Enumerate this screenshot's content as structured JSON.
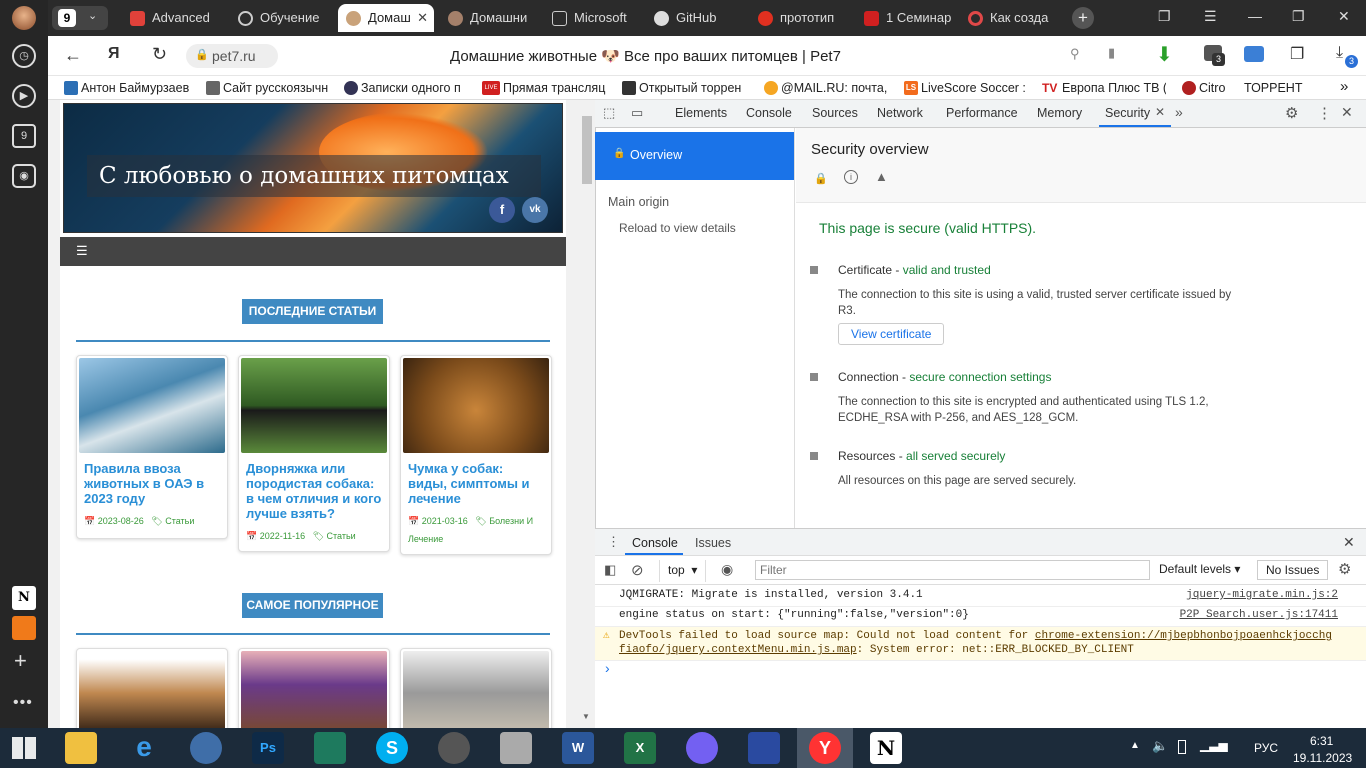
{
  "tabs": [
    {
      "label": "Advanced",
      "icon": "vivaldi-icon"
    },
    {
      "label": "Обучение",
      "icon": "openai-icon"
    },
    {
      "label": "Домаш",
      "icon": "pug-icon",
      "active": true
    },
    {
      "label": "Домашни",
      "icon": "pug-icon"
    },
    {
      "label": "Microsoft",
      "icon": "document-icon"
    },
    {
      "label": "GitHub",
      "icon": "github-icon"
    },
    {
      "label": "прототип",
      "icon": "yandex-icon"
    },
    {
      "label": "1 Семинар",
      "icon": "book-icon"
    },
    {
      "label": "Как созда",
      "icon": "record-icon"
    }
  ],
  "tab_group_count": "9",
  "address": {
    "domain": "pet7.ru",
    "title": "Домашние животные 🐶 Все про ваших питомцев | Pet7"
  },
  "bookmarks": [
    "Антон Баймурзаев",
    "Сайт русскоязычн",
    "Записки одного п",
    "Прямая трансляц",
    "Открытый торрен",
    "@MAIL.RU: почта,",
    "LiveScore Soccer :",
    "Европа Плюс ТВ (",
    "Citro",
    "ТОРРЕНТ"
  ],
  "bookmark_badges": {
    "live": "LIVE",
    "tv": "TV",
    "ls": "LS"
  },
  "site": {
    "banner_text": "С любовью о домашних питомцах",
    "section1": "ПОСЛЕДНИЕ СТАТЬИ",
    "section2": "САМОЕ ПОПУЛЯРНОЕ",
    "articles": [
      {
        "title": "Правила ввоза животных в ОАЭ в 2023 году",
        "date": "2023-08-26",
        "category": "Статьи"
      },
      {
        "title": "Дворняжка или породистая собака: в чем отличия и кого лучше взять?",
        "date": "2022-11-16",
        "category": "Статьи"
      },
      {
        "title": "Чумка у собак: виды, симптомы и лечение",
        "date": "2021-03-16",
        "category": "Болезни И Лечение"
      }
    ]
  },
  "devtools": {
    "tabs": [
      "Elements",
      "Console",
      "Sources",
      "Network",
      "Performance",
      "Memory",
      "Security"
    ],
    "sidebar": {
      "overview": "Overview",
      "main_origin": "Main origin",
      "reload": "Reload to view details"
    },
    "overview_title": "Security overview",
    "secure_message": "This page is secure (valid HTTPS).",
    "certificate": {
      "label": "Certificate - ",
      "status": "valid and trusted",
      "desc": "The connection to this site is using a valid, trusted server certificate issued by R3.",
      "button": "View certificate"
    },
    "connection": {
      "label": "Connection - ",
      "status": "secure connection settings",
      "desc": "The connection to this site is encrypted and authenticated using TLS 1.2, ECDHE_RSA with P-256, and AES_128_GCM."
    },
    "resources": {
      "label": "Resources - ",
      "status": "all served securely",
      "desc": "All resources on this page are served securely."
    },
    "drawer_tabs": [
      "Console",
      "Issues"
    ],
    "context": "top",
    "filter_placeholder": "Filter",
    "levels": "Default levels",
    "issues": "No Issues",
    "log": [
      {
        "text": "JQMIGRATE: Migrate is installed, version 3.4.1",
        "source": "jquery-migrate.min.js:2"
      },
      {
        "text": "engine status on start: {\"running\":false,\"version\":0}",
        "source": "P2P Search.user.js:17411"
      },
      {
        "text": "DevTools failed to load source map: Could not load content for ",
        "link": "chrome-extension://mjbepbhonbojpoaenhckjocchgfiaofo/jquery.contextMenu.min.js.map",
        "tail": ": System error: net::ERR_BLOCKED_BY_CLIENT"
      }
    ],
    "prompt": "›"
  },
  "taskbar": {
    "lang": "РУС",
    "time": "6:31",
    "date": "19.11.2023"
  },
  "badges": {
    "downloads": "3",
    "ext": "3"
  }
}
